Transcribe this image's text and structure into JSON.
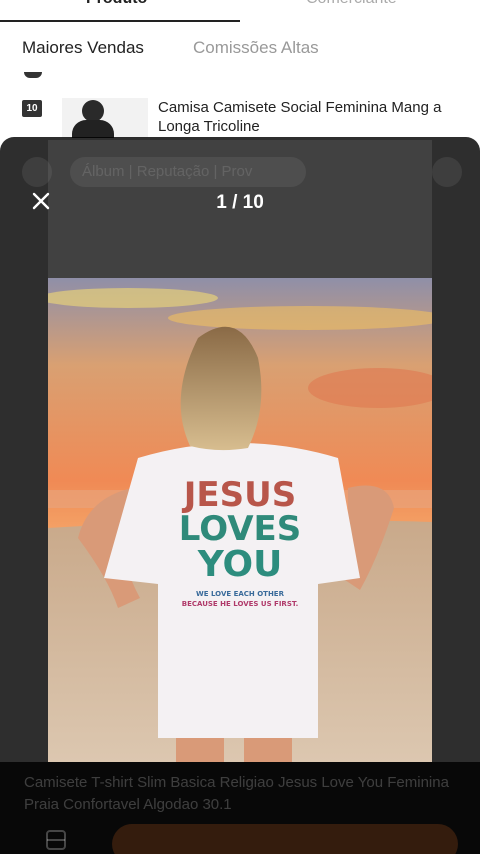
{
  "top_tabs": {
    "left": "Produto",
    "right": "Comerciante"
  },
  "sub_tabs": {
    "selected": "Maiores Vendas",
    "other": "Comissões Altas"
  },
  "list_item": {
    "rank": "10",
    "title": "Camisa Camisete Social Feminina Mang a Longa Tricoline"
  },
  "ghost_header": {
    "tabs": "Álbum  |  Reputação  |  Prov"
  },
  "viewer": {
    "counter": "1 / 10"
  },
  "hero_print": {
    "line1": "JESUS",
    "line2": "LOVES",
    "line3": "YOU",
    "small1": "WE LOVE EACH OTHER",
    "small2": "BECAUSE HE LOVES US FIRST."
  },
  "caption": {
    "text": "Camisete T-shirt Slim Basica Religiao Jesus Love You Feminina Praia Confortavel Algodao 30.1"
  },
  "colors": {
    "overlay": "#000000",
    "accent": "#ff7a28"
  }
}
